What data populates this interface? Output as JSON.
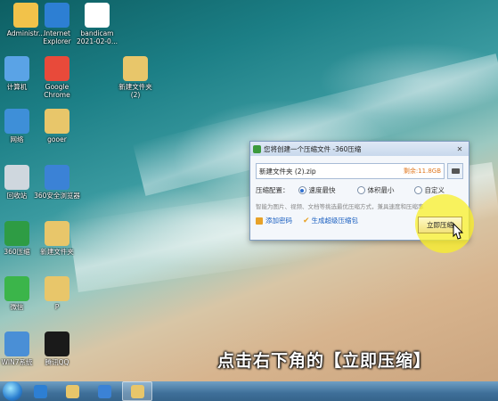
{
  "desktop": {
    "icons": [
      {
        "label": "Administr...",
        "color": "#f2c24a"
      },
      {
        "label": "Internet\nExplorer",
        "color": "#2d7fd3"
      },
      {
        "label": "bandicam\n2021-02-0...",
        "color": "#ffffff"
      },
      {
        "label": "计算机",
        "color": "#5aa3e6"
      },
      {
        "label": "Google\nChrome",
        "color": "#e84a3a"
      },
      {
        "label": "新建文件夹\n(2)",
        "color": "#e8c66a"
      },
      {
        "label": "网络",
        "color": "#3e8fd8"
      },
      {
        "label": "gooer",
        "color": "#e8c66a"
      },
      {
        "label": "回收站",
        "color": "#cfd7de"
      },
      {
        "label": "360安全浏览器",
        "color": "#3b82d6"
      },
      {
        "label": "360压缩",
        "color": "#2e9c44"
      },
      {
        "label": "新建文件夹",
        "color": "#e8c66a"
      },
      {
        "label": "微信",
        "color": "#3bb54a"
      },
      {
        "label": "P",
        "color": "#e8c66a"
      },
      {
        "label": "WIN7系统",
        "color": "#4a8fd6"
      },
      {
        "label": "腾讯QQ",
        "color": "#1a1a1a"
      }
    ]
  },
  "dialog": {
    "title": "您将创建一个压缩文件 -360压缩",
    "close": "✕",
    "filename": "新建文件夹 (2).zip",
    "free_space": "剩余:11.8GB",
    "mode_label": "压缩配置：",
    "options": [
      "速度最快",
      "体积最小",
      "自定义"
    ],
    "hint": "智能为图片、视频、文档等挑选最优压缩方式，兼具速度和压缩率",
    "add_password": "添加密码",
    "super_package": "生成超级压缩包",
    "compress_button": "立即压缩"
  },
  "caption": "点击右下角的【立即压缩】",
  "taskbar": {
    "items": [
      {
        "name": "ie",
        "color": "#2d7fd3"
      },
      {
        "name": "explorer",
        "color": "#e8c66a"
      },
      {
        "name": "browser",
        "color": "#3b82d6"
      },
      {
        "name": "compress",
        "color": "#e8c66a"
      }
    ]
  }
}
